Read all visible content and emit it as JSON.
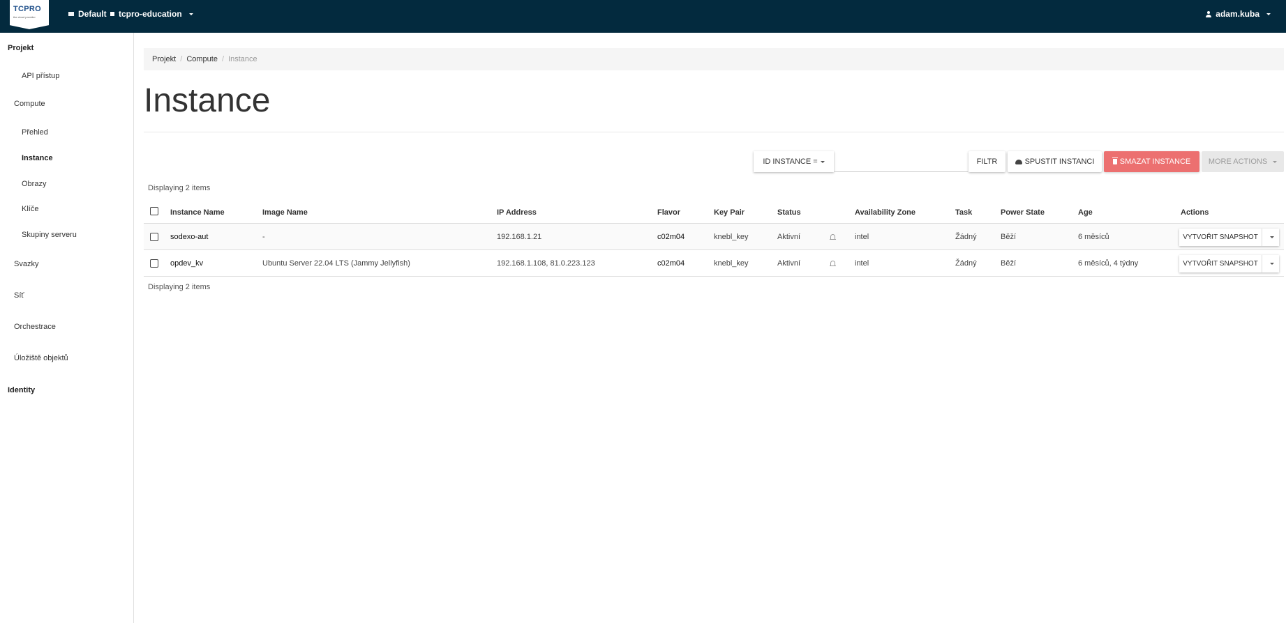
{
  "topbar": {
    "logo_text": "TCPRO",
    "logo_sub": "the cloud provider",
    "domain": "Default",
    "project": "tcpro-education",
    "user": "adam.kuba"
  },
  "sidebar": {
    "items": [
      {
        "label": "Projekt"
      },
      {
        "label": "API přístup"
      },
      {
        "label": "Compute"
      },
      {
        "label": "Přehled"
      },
      {
        "label": "Instance"
      },
      {
        "label": "Obrazy"
      },
      {
        "label": "Klíče"
      },
      {
        "label": "Skupiny serveru"
      },
      {
        "label": "Svazky"
      },
      {
        "label": "Síť"
      },
      {
        "label": "Orchestrace"
      },
      {
        "label": "Úložiště objektů"
      },
      {
        "label": "Identity"
      }
    ]
  },
  "breadcrumb": {
    "items": [
      "Projekt",
      "Compute",
      "Instance"
    ]
  },
  "page": {
    "title": "Instance"
  },
  "toolbar": {
    "filter_field": "ID INSTANCE =",
    "filter_value": "",
    "filter_button": "FILTR",
    "launch_button": "SPUSTIT INSTANCI",
    "delete_button": "SMAZAT INSTANCE",
    "more_button": "MORE ACTIONS"
  },
  "table": {
    "count_label": "Displaying 2 items",
    "columns": [
      "Instance Name",
      "Image Name",
      "IP Address",
      "Flavor",
      "Key Pair",
      "Status",
      "Availability Zone",
      "Task",
      "Power State",
      "Age",
      "Actions"
    ],
    "rows": [
      {
        "name": "sodexo-aut",
        "image": "-",
        "ip": "192.168.1.21",
        "flavor": "c02m04",
        "keypair": "knebl_key",
        "status": "Aktivní",
        "zone": "intel",
        "task": "Žádný",
        "power": "Běží",
        "age": "6 měsíců",
        "action": "VYTVOŘIT SNAPSHOT"
      },
      {
        "name": "opdev_kv",
        "image": "Ubuntu Server 22.04 LTS (Jammy Jellyfish)",
        "ip": "192.168.1.108, 81.0.223.123",
        "flavor": "c02m04",
        "keypair": "knebl_key",
        "status": "Aktivní",
        "zone": "intel",
        "task": "Žádný",
        "power": "Běží",
        "age": "6 měsíců, 4 týdny",
        "action": "VYTVOŘIT SNAPSHOT"
      }
    ]
  },
  "colors": {
    "topbar": "#032a3e",
    "danger": "#ec7070"
  }
}
